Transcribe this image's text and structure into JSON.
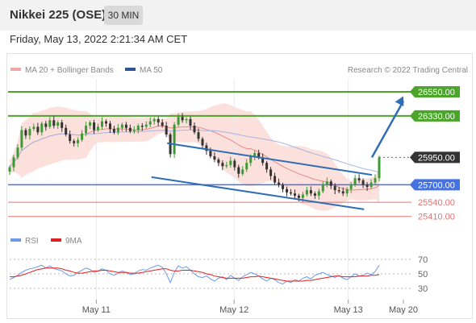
{
  "header": {
    "title": "Nikkei 225 (OSE)",
    "timeframe": "30 MIN"
  },
  "datetime": "Friday, May 13, 2022 2:21:34 AM CET",
  "legend": {
    "ma20_bb": "MA 20 + Bollinger Bands",
    "ma50": "MA 50",
    "rsi": "RSI",
    "ma9": "9MA",
    "copyright": "Research © 2022 Trading Central"
  },
  "colors": {
    "bull": "#3d9b35",
    "bear": "#333333",
    "bollinger": "#fbd5d0",
    "ma20": "#e58a8a",
    "ma50": "#a8b3e3",
    "support": "#4472e3",
    "resistance": "#4aa52a",
    "minor": "#e57373",
    "arrow": "#2f6db5",
    "rsi": "#6b9be8",
    "rsi_ma": "#e02020"
  },
  "chart_data": [
    {
      "type": "candlestick",
      "y_range": [
        25290,
        26690
      ],
      "x_ticks": [
        "May 11",
        "May 12",
        "May 13",
        "May 20"
      ],
      "last_price": 25950.0,
      "levels": [
        {
          "label": "26550.00",
          "value": 26550,
          "kind": "resistance"
        },
        {
          "label": "26330.00",
          "value": 26330,
          "kind": "resistance"
        },
        {
          "label": "25950.00",
          "value": 25950,
          "kind": "last"
        },
        {
          "label": "25700.00",
          "value": 25700,
          "kind": "support"
        },
        {
          "label": "25540.00",
          "value": 25540,
          "kind": "minor"
        },
        {
          "label": "25410.00",
          "value": 25410,
          "kind": "minor"
        }
      ],
      "channel": {
        "upper": [
          [
            0.4,
            26080
          ],
          [
            0.92,
            25790
          ]
        ],
        "lower": [
          [
            0.36,
            25770
          ],
          [
            0.9,
            25475
          ]
        ]
      },
      "projection": {
        "from": [
          0.92,
          25950
        ],
        "to": [
          1.0,
          26510
        ]
      },
      "closes": [
        25860,
        25950,
        26040,
        26200,
        26150,
        26210,
        26230,
        26180,
        26260,
        26230,
        26290,
        26240,
        26270,
        26220,
        26160,
        26100,
        26080,
        26110,
        26170,
        26240,
        26270,
        26200,
        26230,
        26280,
        26260,
        26210,
        26180,
        26220,
        26250,
        26220,
        26190,
        26200,
        26240,
        26230,
        26250,
        26280,
        26300,
        26270,
        26240,
        26160,
        25980,
        26250,
        26320,
        26290,
        26300,
        26240,
        26180,
        26120,
        26060,
        26010,
        25960,
        25930,
        25900,
        25870,
        25880,
        25920,
        25860,
        25800,
        25840,
        25900,
        25960,
        25990,
        25950,
        25900,
        25840,
        25780,
        25720,
        25700,
        25660,
        25630,
        25620,
        25600,
        25580,
        25610,
        25650,
        25620,
        25600,
        25640,
        25700,
        25730,
        25690,
        25650,
        25640,
        25620,
        25660,
        25700,
        25760,
        25740,
        25700,
        25680,
        25720,
        25760,
        25950
      ]
    },
    {
      "type": "line",
      "name": "RSI",
      "y_ticks": [
        70,
        50,
        30
      ],
      "values": [
        42,
        45,
        48,
        52,
        55,
        57,
        58,
        60,
        62,
        58,
        61,
        57,
        56,
        54,
        50,
        47,
        48,
        52,
        55,
        58,
        56,
        52,
        54,
        57,
        55,
        50,
        48,
        51,
        54,
        52,
        49,
        50,
        54,
        56,
        55,
        58,
        60,
        62,
        59,
        50,
        38,
        52,
        61,
        58,
        60,
        55,
        50,
        46,
        45,
        47,
        43,
        40,
        44,
        46,
        42,
        48,
        44,
        41,
        46,
        49,
        52,
        50,
        47,
        43,
        40,
        44,
        42,
        38,
        36,
        40,
        38,
        42,
        40,
        44,
        46,
        43,
        48,
        50,
        52,
        49,
        47,
        45,
        48,
        44,
        42,
        46,
        50,
        47,
        48,
        51,
        49,
        53,
        62
      ]
    },
    {
      "type": "line",
      "name": "9MA",
      "values": [
        46,
        46,
        47,
        48,
        50,
        52,
        54,
        56,
        57,
        58,
        58,
        58,
        58,
        57,
        55,
        54,
        52,
        51,
        51,
        52,
        53,
        54,
        54,
        55,
        55,
        54,
        53,
        52,
        52,
        52,
        51,
        51,
        51,
        52,
        53,
        54,
        55,
        56,
        57,
        57,
        55,
        54,
        54,
        55,
        55,
        55,
        54,
        53,
        52,
        50,
        49,
        47,
        46,
        45,
        44,
        44,
        44,
        44,
        44,
        45,
        46,
        46,
        47,
        46,
        45,
        44,
        43,
        42,
        41,
        40,
        40,
        40,
        40,
        40,
        41,
        41,
        42,
        43,
        44,
        45,
        46,
        47,
        47,
        46,
        46,
        46,
        46,
        47,
        47,
        47,
        48,
        48,
        49
      ]
    }
  ]
}
